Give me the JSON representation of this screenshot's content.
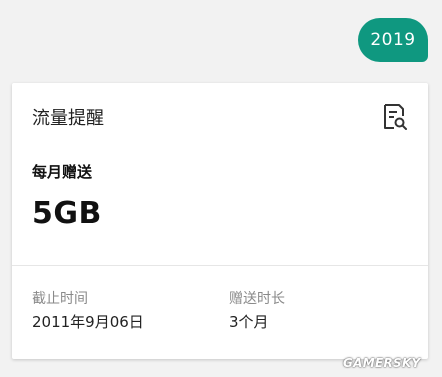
{
  "chat": {
    "bubble_text": "2019"
  },
  "card": {
    "title": "流量提醒",
    "detail_icon": "document-search-icon",
    "gift_label": "每月赠送",
    "amount": "5GB",
    "fields": [
      {
        "label": "截止时间",
        "value": "2011年9月06日"
      },
      {
        "label": "赠送时长",
        "value": "3个月"
      }
    ]
  },
  "watermark": "GAMERSKY",
  "colors": {
    "accent": "#0f9880",
    "background": "#f2f2f2",
    "card": "#ffffff",
    "secondary_text": "#8a8a8a"
  }
}
